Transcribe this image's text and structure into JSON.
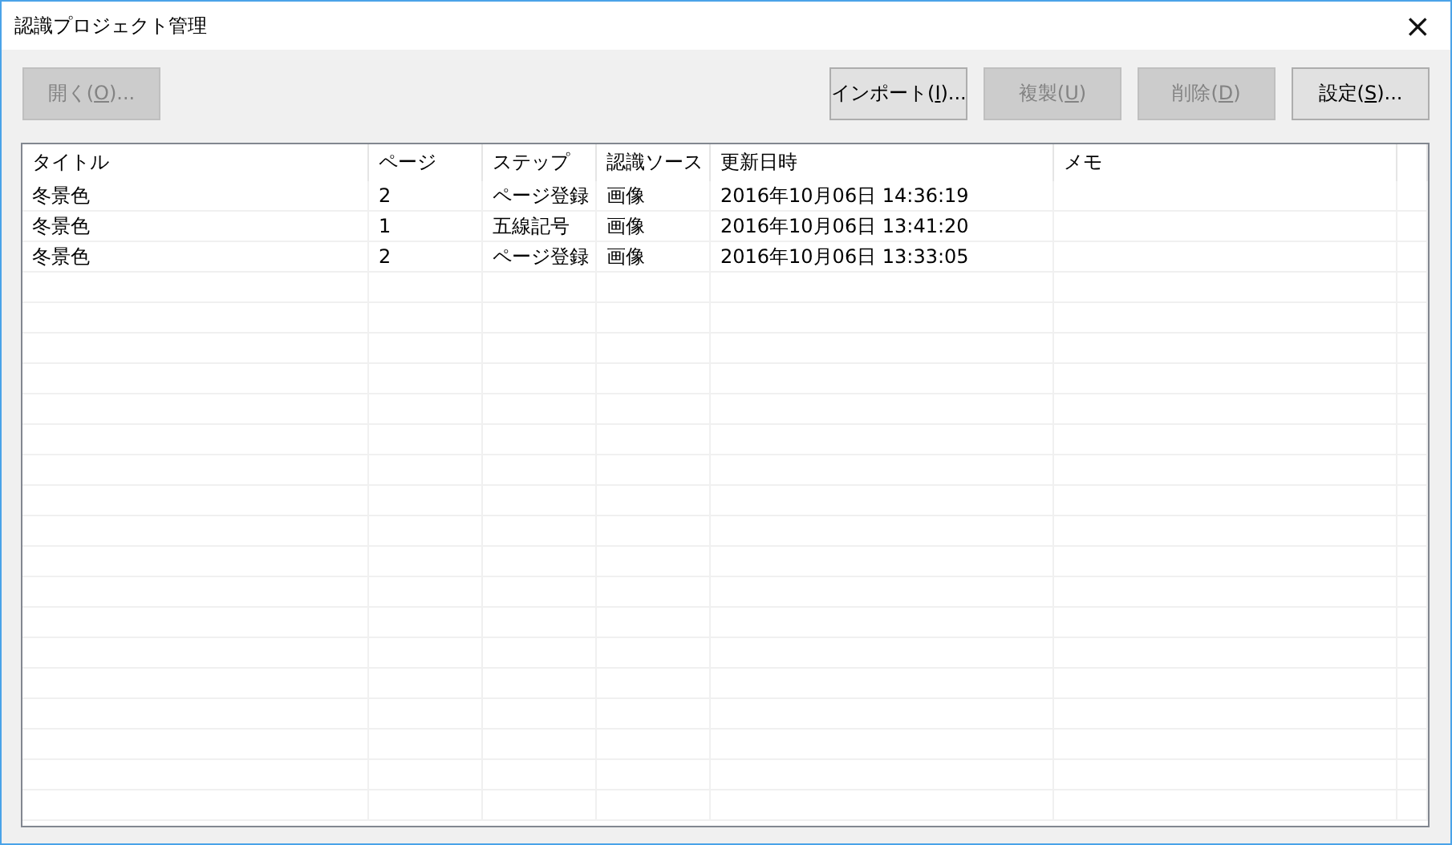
{
  "window": {
    "title": "認識プロジェクト管理",
    "close": "×"
  },
  "left_buttons": [
    {
      "before": "開く(",
      "mnemonic": "O",
      "after": ")...",
      "disabled": true
    }
  ],
  "right_buttons": [
    {
      "before": "インポート(",
      "mnemonic": "I",
      "after": ")...",
      "disabled": false
    },
    {
      "before": "複製(",
      "mnemonic": "U",
      "after": ")",
      "disabled": true
    },
    {
      "before": "削除(",
      "mnemonic": "D",
      "after": ")",
      "disabled": true
    },
    {
      "before": "設定(",
      "mnemonic": "S",
      "after": ")...",
      "disabled": false
    }
  ],
  "table": {
    "columns": [
      "タイトル",
      "ページ",
      "ステップ",
      "認識ソース",
      "更新日時",
      "メモ"
    ],
    "rows": [
      {
        "cells": [
          "冬景色",
          "2",
          "ページ登録",
          "画像",
          "2016年10月06日 14:36:19"
        ],
        "selected": false
      },
      {
        "cells": [
          "冬景色",
          "1",
          "五線記号",
          "画像",
          "2016年10月06日 13:41:20"
        ],
        "selected": false
      },
      {
        "cells": [
          "冬景色",
          "2",
          "ページ登録",
          "画像",
          "2016年10月06日 13:33:05"
        ],
        "selected": false
      }
    ]
  }
}
